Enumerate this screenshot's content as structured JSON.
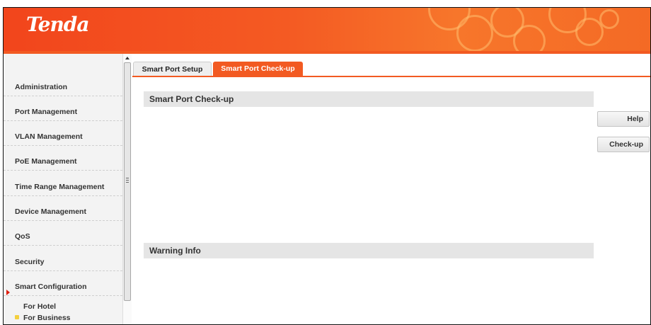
{
  "brand": {
    "logo": "Tenda"
  },
  "sidebar": {
    "items": [
      {
        "label": "Administration"
      },
      {
        "label": "Port Management"
      },
      {
        "label": "VLAN Management"
      },
      {
        "label": "PoE Management"
      },
      {
        "label": "Time Range Management"
      },
      {
        "label": "Device Management"
      },
      {
        "label": "QoS"
      },
      {
        "label": "Security"
      },
      {
        "label": "Smart Configuration"
      }
    ],
    "subitems": [
      {
        "label": "For Hotel"
      },
      {
        "label": "For Business"
      }
    ]
  },
  "tabs": [
    {
      "label": "Smart Port Setup",
      "active": false
    },
    {
      "label": "Smart Port Check-up",
      "active": true
    }
  ],
  "main": {
    "section_title": "Smart Port Check-up",
    "warning_title": "Warning Info"
  },
  "buttons": {
    "help_label": "Help",
    "checkup_label": "Check-up"
  },
  "colors": {
    "accent": "#f25a22",
    "tab_active": "#f25a22",
    "section_bar": "#e5e5e5",
    "sidebar_bg": "#f3f3f3"
  }
}
